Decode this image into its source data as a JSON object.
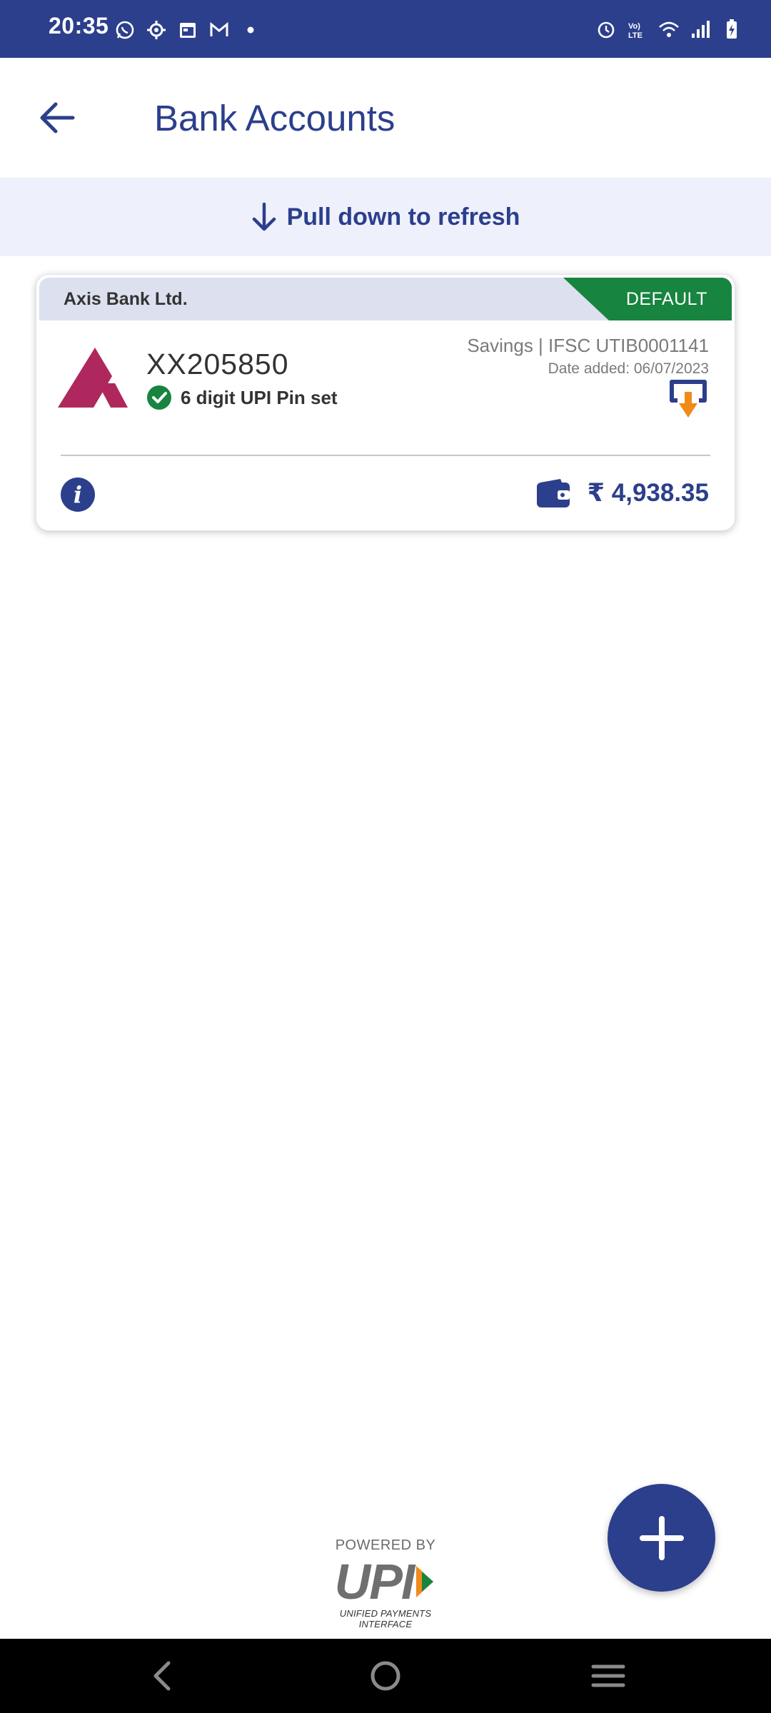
{
  "status_bar": {
    "time": "20:35",
    "left_icons": [
      "whatsapp-icon",
      "settings-icon",
      "calendar-icon",
      "gmail-icon",
      "dot-icon"
    ],
    "right_icons": [
      "alarm-icon",
      "volte-icon",
      "wifi-icon",
      "signal-icon",
      "battery-charging-icon"
    ]
  },
  "header": {
    "title": "Bank Accounts",
    "back_icon": "arrow-left-icon"
  },
  "refresh_banner": {
    "text": "Pull down to refresh",
    "icon": "arrow-down-icon"
  },
  "account_card": {
    "bank_name": "Axis Bank Ltd.",
    "default_label": "DEFAULT",
    "account_number": "XX205850",
    "pin_status": "6 digit UPI Pin set",
    "account_type_ifsc": "Savings | IFSC UTIB0001141",
    "date_added": "Date added: 06/07/2023",
    "balance": "₹ 4,938.35",
    "info_icon_text": "i"
  },
  "footer": {
    "powered_by": "POWERED BY",
    "upi": "UPI",
    "upi_full": "UNIFIED PAYMENTS INTERFACE"
  },
  "colors": {
    "primary": "#2c3f8c",
    "default_badge": "#17843f",
    "axis_logo": "#ae285d",
    "header_bg": "#dde0ee",
    "banner_bg": "#eef0fb",
    "download_arrow": "#f08a1c"
  }
}
